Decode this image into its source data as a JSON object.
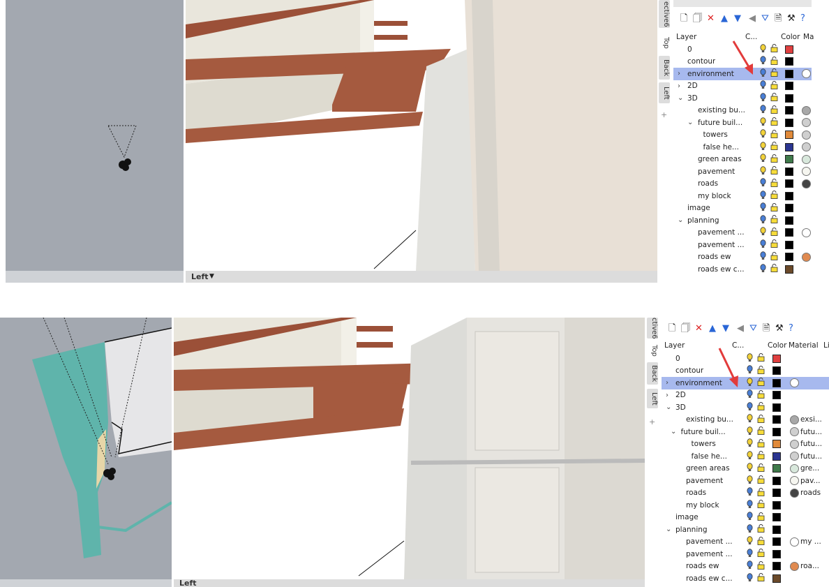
{
  "top": {
    "vtabs": [
      "ective6",
      "Top",
      "Back",
      "Left"
    ],
    "bottom_bar_label": "Left",
    "panel": {
      "headers": {
        "layer": "Layer",
        "current": "C...",
        "color": "Color",
        "material": "Ma"
      },
      "rows": [
        {
          "name": "0",
          "indent": 0,
          "chev": "",
          "color": "#e04040",
          "mat": "",
          "bulb": "#f2d23a"
        },
        {
          "name": "contour",
          "indent": 0,
          "chev": "",
          "color": "#000000",
          "mat": "",
          "bulb": "#4a7fd6"
        },
        {
          "name": "environment",
          "indent": 0,
          "chev": "›",
          "color": "#000000",
          "mat": "#ffffff",
          "bulb": "#4a7fd6",
          "selected": true
        },
        {
          "name": "2D",
          "indent": 0,
          "chev": "›",
          "color": "#000000",
          "mat": "",
          "bulb": "#4a7fd6"
        },
        {
          "name": "3D",
          "indent": 0,
          "chev": "⌄",
          "color": "#000000",
          "mat": "",
          "bulb": "#4a7fd6"
        },
        {
          "name": "existing bu...",
          "indent": 2,
          "chev": "",
          "color": "#000000",
          "mat": "#a8a8a8",
          "bulb": "#4a7fd6"
        },
        {
          "name": "future buil...",
          "indent": 2,
          "chev": "⌄",
          "color": "#000000",
          "mat": "#cfcfcf",
          "bulb": "#f2d23a"
        },
        {
          "name": "towers",
          "indent": 3,
          "chev": "",
          "color": "#e08a3a",
          "mat": "#cfcfcf",
          "bulb": "#f2d23a"
        },
        {
          "name": "false he...",
          "indent": 3,
          "chev": "",
          "color": "#2b3590",
          "mat": "#cfcfcf",
          "bulb": "#f2d23a"
        },
        {
          "name": "green areas",
          "indent": 2,
          "chev": "",
          "color": "#3f7a4a",
          "mat": "#d8e8dc",
          "bulb": "#f2d23a"
        },
        {
          "name": "pavement",
          "indent": 2,
          "chev": "",
          "color": "#000000",
          "mat": "#f6f6f0",
          "bulb": "#f2d23a"
        },
        {
          "name": "roads",
          "indent": 2,
          "chev": "",
          "color": "#000000",
          "mat": "#444444",
          "bulb": "#4a7fd6"
        },
        {
          "name": "my block",
          "indent": 2,
          "chev": "",
          "color": "#000000",
          "mat": "",
          "bulb": "#4a7fd6"
        },
        {
          "name": "image",
          "indent": 0,
          "chev": "",
          "color": "#000000",
          "mat": "",
          "bulb": "#4a7fd6"
        },
        {
          "name": "planning",
          "indent": 0,
          "chev": "⌄",
          "color": "#000000",
          "mat": "",
          "bulb": "#4a7fd6"
        },
        {
          "name": "pavement ...",
          "indent": 2,
          "chev": "",
          "color": "#000000",
          "mat": "#ffffff",
          "bulb": "#f2d23a"
        },
        {
          "name": "pavement ...",
          "indent": 2,
          "chev": "",
          "color": "#000000",
          "mat": "",
          "bulb": "#4a7fd6"
        },
        {
          "name": "roads ew",
          "indent": 2,
          "chev": "",
          "color": "#000000",
          "mat": "#e08a50",
          "bulb": "#4a7fd6"
        },
        {
          "name": "roads ew c...",
          "indent": 2,
          "chev": "",
          "color": "#6b4a2a",
          "mat": "",
          "bulb": "#4a7fd6"
        }
      ]
    }
  },
  "bottom": {
    "vtabs": [
      "ctive6",
      "Top",
      "Back",
      "Left"
    ],
    "bottom_bar_label": "Left",
    "panel": {
      "headers": {
        "layer": "Layer",
        "current": "C...",
        "color": "Color",
        "material": "Material",
        "linetype": "Li"
      },
      "rows": [
        {
          "name": "0",
          "indent": 0,
          "chev": "",
          "color": "#e04040",
          "mat": "",
          "matname": "",
          "bulb": "#f2d23a"
        },
        {
          "name": "contour",
          "indent": 0,
          "chev": "",
          "color": "#000000",
          "mat": "",
          "matname": "",
          "bulb": "#4a7fd6"
        },
        {
          "name": "environment",
          "indent": 0,
          "chev": "›",
          "color": "#000000",
          "mat": "#ffffff",
          "matname": "",
          "bulb": "#f2d23a",
          "selected": true
        },
        {
          "name": "2D",
          "indent": 0,
          "chev": "›",
          "color": "#000000",
          "mat": "",
          "matname": "",
          "bulb": "#4a7fd6"
        },
        {
          "name": "3D",
          "indent": 0,
          "chev": "⌄",
          "color": "#000000",
          "mat": "",
          "matname": "",
          "bulb": "#4a7fd6"
        },
        {
          "name": "existing bu...",
          "indent": 2,
          "chev": "",
          "color": "#000000",
          "mat": "#a8a8a8",
          "matname": "exsi...",
          "bulb": "#f2d23a"
        },
        {
          "name": "future buil...",
          "indent": 1,
          "chev": "⌄",
          "color": "#000000",
          "mat": "#cfcfcf",
          "matname": "futu...",
          "bulb": "#f2d23a"
        },
        {
          "name": "towers",
          "indent": 3,
          "chev": "",
          "color": "#e08a3a",
          "mat": "#cfcfcf",
          "matname": "futu...",
          "bulb": "#f2d23a"
        },
        {
          "name": "false he...",
          "indent": 3,
          "chev": "",
          "color": "#2b3590",
          "mat": "#cfcfcf",
          "matname": "futu...",
          "bulb": "#f2d23a"
        },
        {
          "name": "green areas",
          "indent": 2,
          "chev": "",
          "color": "#3f7a4a",
          "mat": "#d8e8dc",
          "matname": "gre...",
          "bulb": "#f2d23a"
        },
        {
          "name": "pavement",
          "indent": 2,
          "chev": "",
          "color": "#000000",
          "mat": "#f6f6f0",
          "matname": "pav...",
          "bulb": "#f2d23a"
        },
        {
          "name": "roads",
          "indent": 2,
          "chev": "",
          "color": "#000000",
          "mat": "#444444",
          "matname": "roads",
          "bulb": "#4a7fd6"
        },
        {
          "name": "my block",
          "indent": 2,
          "chev": "",
          "color": "#000000",
          "mat": "",
          "matname": "",
          "bulb": "#4a7fd6"
        },
        {
          "name": "image",
          "indent": 0,
          "chev": "",
          "color": "#000000",
          "mat": "",
          "matname": "",
          "bulb": "#4a7fd6"
        },
        {
          "name": "planning",
          "indent": 0,
          "chev": "⌄",
          "color": "#000000",
          "mat": "",
          "matname": "",
          "bulb": "#4a7fd6"
        },
        {
          "name": "pavement ...",
          "indent": 2,
          "chev": "",
          "color": "#000000",
          "mat": "#ffffff",
          "matname": "my ...",
          "bulb": "#f2d23a"
        },
        {
          "name": "pavement ...",
          "indent": 2,
          "chev": "",
          "color": "#000000",
          "mat": "",
          "matname": "",
          "bulb": "#4a7fd6"
        },
        {
          "name": "roads ew",
          "indent": 2,
          "chev": "",
          "color": "#000000",
          "mat": "#e08a50",
          "matname": "roa...",
          "bulb": "#4a7fd6"
        },
        {
          "name": "roads ew c...",
          "indent": 2,
          "chev": "",
          "color": "#6b4a2a",
          "mat": "",
          "matname": "",
          "bulb": "#4a7fd6"
        }
      ]
    }
  },
  "colors": {
    "selection": "#a7b9ee",
    "viewport_gray": "#a3a8b0",
    "road": "#a05a40",
    "arrow": "#e23b3b",
    "water": "#5fb4ab"
  },
  "toolbar_icons": [
    "new-layer-icon",
    "new-sublayer-icon",
    "delete-icon",
    "move-up-icon",
    "move-down-icon",
    "move-left-icon",
    "filter-icon",
    "properties-icon",
    "tools-icon",
    "help-icon"
  ]
}
